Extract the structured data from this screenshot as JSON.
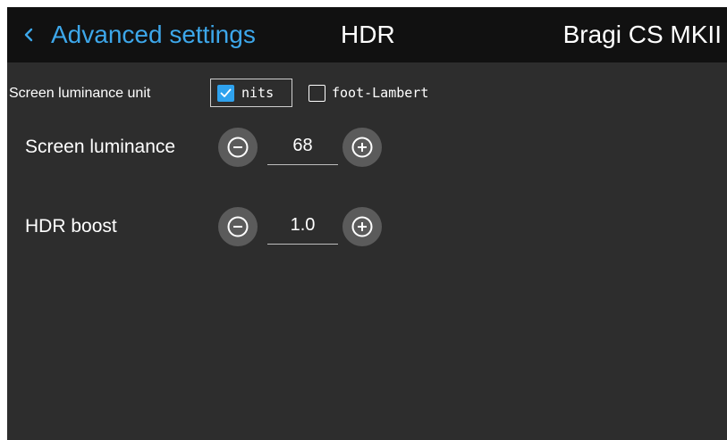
{
  "header": {
    "back_label": "Advanced settings",
    "title": "HDR",
    "device": "Bragi CS MKII"
  },
  "unit": {
    "label": "Screen luminance unit",
    "options": [
      {
        "label": "nits",
        "checked": true
      },
      {
        "label": "foot-Lambert",
        "checked": false
      }
    ]
  },
  "settings": {
    "screen_luminance": {
      "label": "Screen luminance",
      "value": "68"
    },
    "hdr_boost": {
      "label": "HDR boost",
      "value": "1.0"
    }
  },
  "colors": {
    "accent": "#3da7ea",
    "checkbox": "#2fa2ee",
    "header_bg": "#111111",
    "panel_bg": "#2d2d2d",
    "round_button": "#5b5b5b"
  },
  "icons": {
    "back": "chevron-left-icon",
    "decrease": "minus-circle-icon",
    "increase": "plus-circle-icon",
    "check": "checkmark-icon"
  }
}
